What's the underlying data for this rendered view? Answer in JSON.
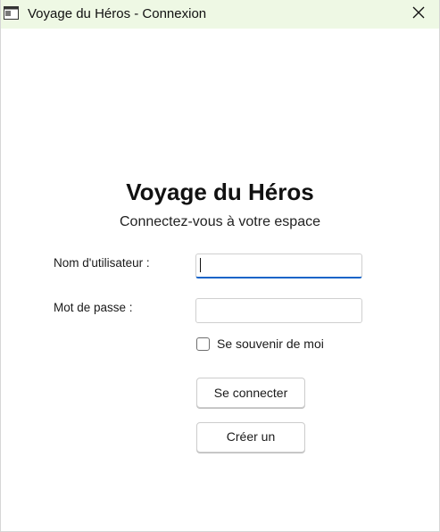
{
  "window": {
    "title": "Voyage du Héros - Connexion",
    "titlebar_color": "#eef8e4"
  },
  "header": {
    "title": "Voyage du Héros",
    "subtitle": "Connectez-vous à votre espace"
  },
  "form": {
    "username_label": "Nom d'utilisateur :",
    "username_value": "",
    "password_label": "Mot de passe :",
    "password_value": "",
    "remember_label": "Se souvenir de moi",
    "remember_checked": false
  },
  "actions": {
    "login_label": "Se connecter",
    "create_label": "Créer un"
  },
  "colors": {
    "focus_accent": "#1864c8"
  },
  "icons": {
    "app": "window-app-icon",
    "close": "close-icon"
  }
}
